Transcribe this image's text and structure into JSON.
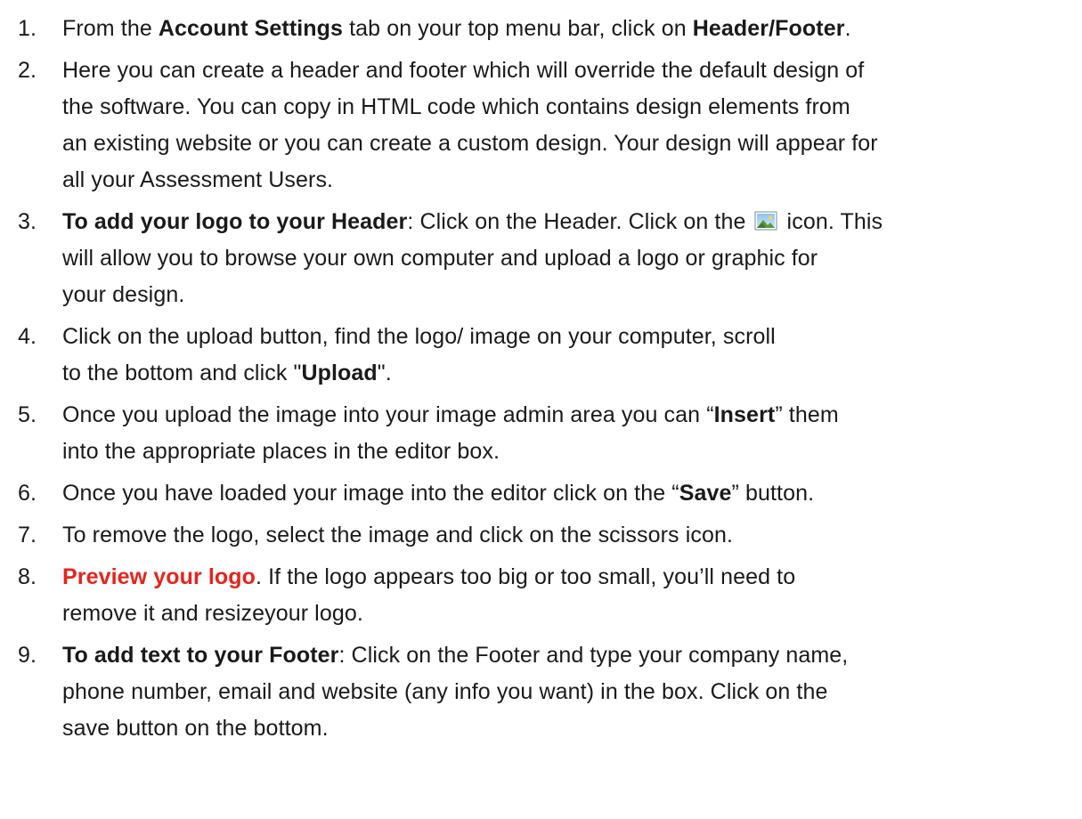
{
  "steps": [
    {
      "num": "1.",
      "lines": [
        {
          "a": "From the ",
          "b": "Account Settings",
          "c": " tab on your top menu bar, click on ",
          "d": "Header/Footer",
          "e": "."
        }
      ]
    },
    {
      "num": "2.",
      "lines": [
        "Here you can create a header and footer which will override the default design of",
        "the software. You can copy in HTML code which contains design elements from",
        "an existing website or you can create a custom design. Your design will appear for",
        "all your Assessment Users."
      ]
    },
    {
      "num": "3.",
      "bold": "To add your logo to your Header",
      "after_bold": ": Click on the Header. Click on the ",
      "icon": "image-insert-icon",
      "after_icon": " icon.  This",
      "lines": [
        "will allow you to browse your own computer and upload a logo or graphic for",
        "your design."
      ]
    },
    {
      "num": "4.",
      "line1": "Click on the upload button, find the logo/ image on your computer, scroll",
      "line2_a": "to the bottom and click \"",
      "line2_b": "Upload",
      "line2_c": "\"."
    },
    {
      "num": "5.",
      "line1_a": "Once you upload the image into your image admin area you can “",
      "line1_b": "Insert",
      "line1_c": "” them",
      "line2": "into the appropriate places in the editor box."
    },
    {
      "num": "6.",
      "a": " Once you have loaded your image into the editor click on the “",
      "b": "Save",
      "c": "” button."
    },
    {
      "num": "7.",
      "text": "To remove the logo, select the image and click on the scissors icon."
    },
    {
      "num": "8.",
      "red": "Preview your logo",
      "after_red": ". If the logo appears too big or too small, you’ll need to",
      "line2": "remove it and resizeyour logo."
    },
    {
      "num": "9.",
      "bold": "To add text to your Footer",
      "after_bold": ": Click on the Footer and type your company name,",
      "line2": "phone number, email and website (any info you want) in the box. Click on the",
      "line3": "save button on the bottom."
    }
  ],
  "colors": {
    "text": "#1a1a1a",
    "highlight_red": "#e8231b"
  }
}
